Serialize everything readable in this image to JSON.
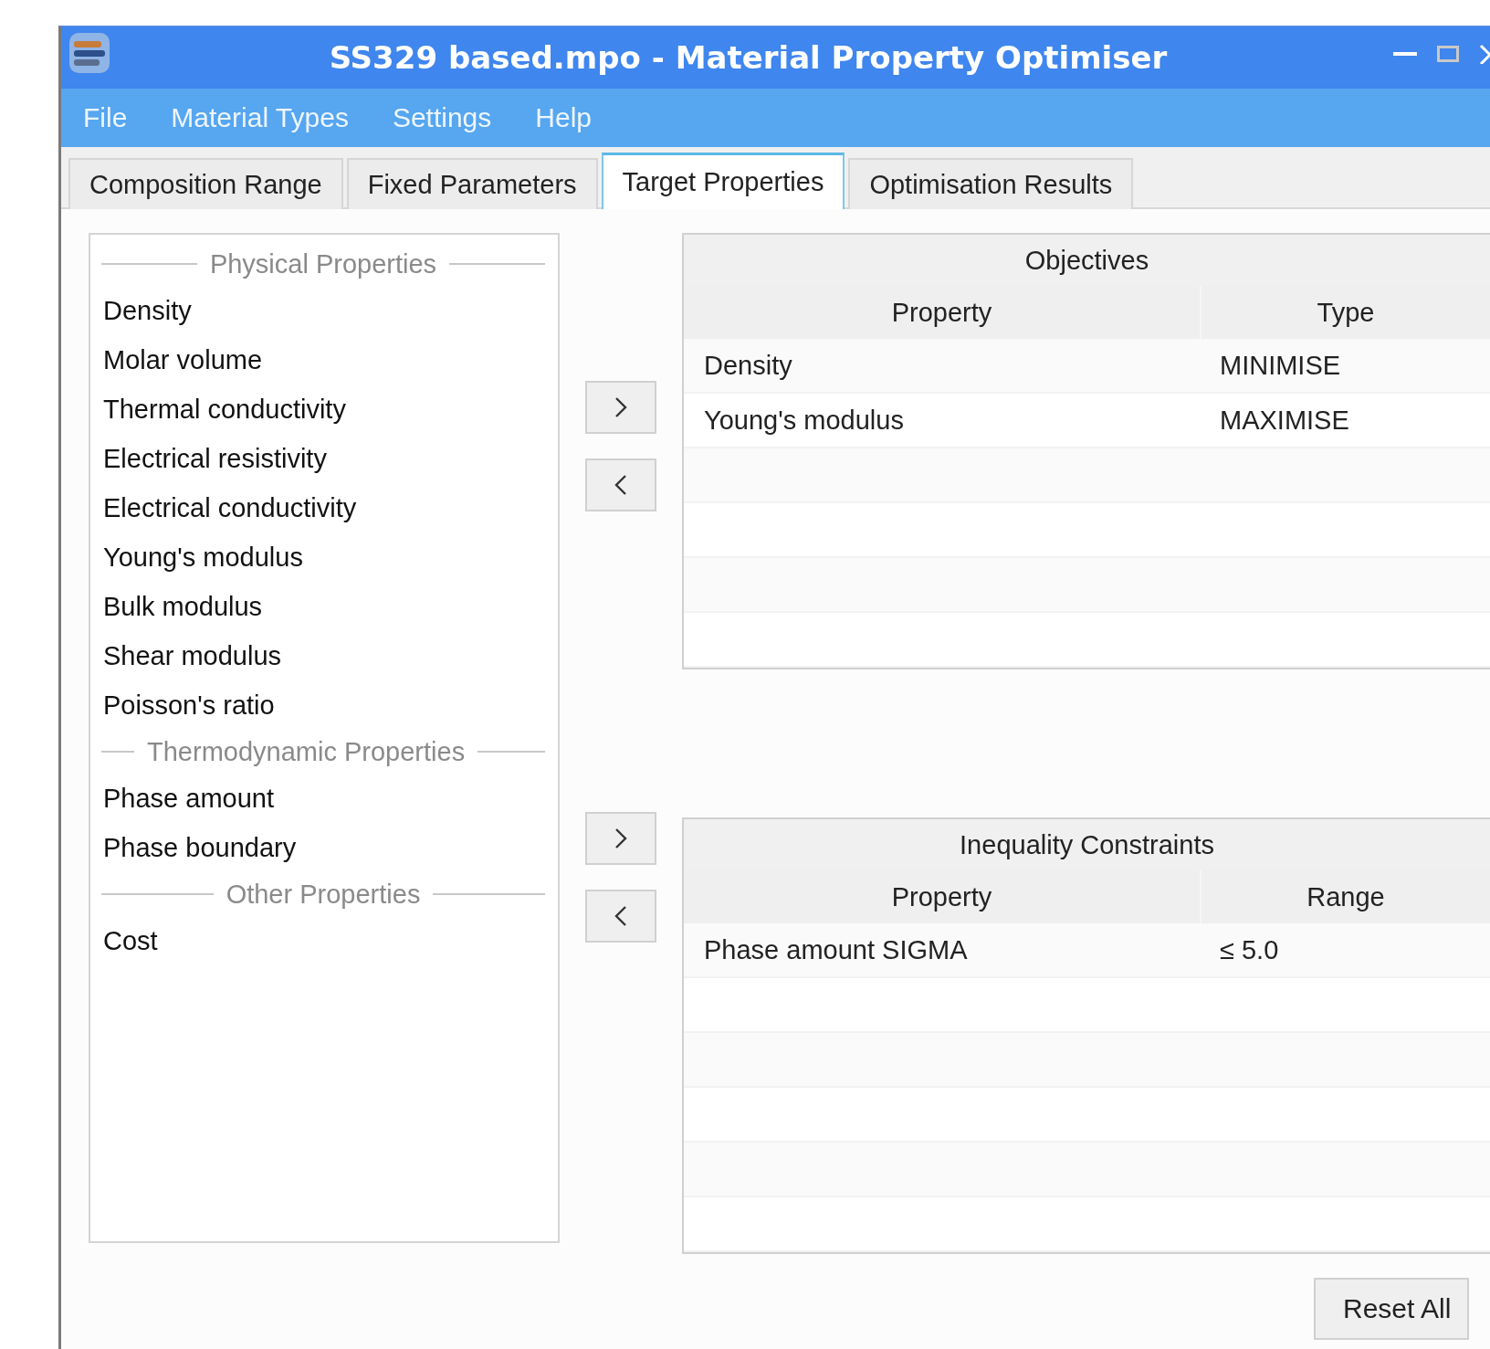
{
  "window": {
    "title": "SS329 based.mpo - Material Property Optimiser"
  },
  "menu": [
    "File",
    "Material Types",
    "Settings",
    "Help"
  ],
  "tabs": [
    {
      "label": "Composition Range",
      "selected": false
    },
    {
      "label": "Fixed Parameters",
      "selected": false
    },
    {
      "label": "Target Properties",
      "selected": true
    },
    {
      "label": "Optimisation Results",
      "selected": false
    }
  ],
  "property_list": [
    {
      "group": "Physical Properties",
      "items": [
        "Density",
        "Molar volume",
        "Thermal conductivity",
        "Electrical resistivity",
        "Electrical conductivity",
        "Young's modulus",
        "Bulk modulus",
        "Shear modulus",
        "Poisson's ratio"
      ]
    },
    {
      "group": "Thermodynamic Properties",
      "items": [
        "Phase amount",
        "Phase boundary"
      ]
    },
    {
      "group": "Other Properties",
      "items": [
        "Cost"
      ]
    }
  ],
  "objectives": {
    "title": "Objectives",
    "columns": [
      "Property",
      "Type"
    ],
    "rows": [
      [
        "Density",
        "MINIMISE"
      ],
      [
        "Young's modulus",
        "MAXIMISE"
      ]
    ]
  },
  "inequality_constraints": {
    "title": "Inequality Constraints",
    "columns": [
      "Property",
      "Range"
    ],
    "rows": [
      [
        "Phase amount SIGMA",
        "≤ 5.0"
      ]
    ]
  },
  "reset_button": "Reset All"
}
